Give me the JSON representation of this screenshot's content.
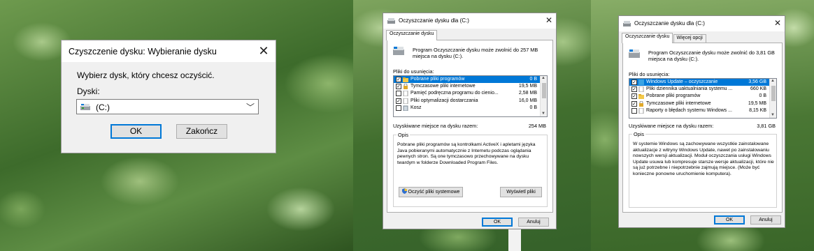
{
  "dialog1": {
    "title": "Czyszczenie dysku: Wybieranie dysku",
    "prompt": "Wybierz dysk, który chcesz oczyścić.",
    "drives_label": "Dyski:",
    "selected_drive": "(C:)",
    "ok": "OK",
    "cancel": "Zakończ"
  },
  "dialog2": {
    "title": "Oczyszczanie dysku dla  (C:)",
    "tab": "Oczyszczanie dysku",
    "summary": "Program Oczyszczanie dysku może zwolnić do 257 MB miejsca na dysku  (C:).",
    "files_label": "Pliki do usunięcia:",
    "files": [
      {
        "name": "Pobrane pliki programów",
        "size": "0 B",
        "checked": true,
        "selected": true,
        "icon": "folder-icon"
      },
      {
        "name": "Tymczasowe pliki internetowe",
        "size": "19,5 MB",
        "checked": true,
        "selected": false,
        "icon": "lock-icon"
      },
      {
        "name": "Pamięć podręczna programu do cienio...",
        "size": "2,58 MB",
        "checked": false,
        "selected": false,
        "icon": "file-icon"
      },
      {
        "name": "Pliki optymalizacji dostarczania",
        "size": "16,0 MB",
        "checked": true,
        "selected": false,
        "icon": "file-icon"
      },
      {
        "name": "Kosz",
        "size": "0 B",
        "checked": false,
        "selected": false,
        "icon": "recycle-bin-icon"
      }
    ],
    "total_label": "Uzyskiwane miejsce na dysku razem:",
    "total_value": "254 MB",
    "desc_legend": "Opis",
    "description": "Pobrane pliki programów są kontrolkami ActiveX i apletami języka Java pobieranymi automatycznie z Internetu podczas oglądania pewnych stron. Są one tymczasowo przechowywane na dysku twardym w folderze Downloaded Program Files.",
    "cleanup_system_button": "Oczyść pliki systemowe",
    "view_files_button": "Wyświetl pliki",
    "ok": "OK",
    "cancel": "Anuluj"
  },
  "dialog3": {
    "title": "Oczyszczanie dysku dla  (C:)",
    "tab1": "Oczyszczanie dysku",
    "tab2": "Więcej opcji",
    "summary": "Program Oczyszczanie dysku może zwolnić do 3,81 GB miejsca na dysku  (C:).",
    "files_label": "Pliki do usunięcia:",
    "files": [
      {
        "name": "Windows Update – oczyszczanie",
        "size": "3,56 GB",
        "checked": true,
        "selected": true,
        "icon": "windows-update-icon"
      },
      {
        "name": "Pliki dziennika uaktualniania systemu ...",
        "size": "660 KB",
        "checked": true,
        "selected": false,
        "icon": "file-icon"
      },
      {
        "name": "Pobrane pliki programów",
        "size": "0 B",
        "checked": true,
        "selected": false,
        "icon": "folder-icon"
      },
      {
        "name": "Tymczasowe pliki internetowe",
        "size": "19,5 MB",
        "checked": true,
        "selected": false,
        "icon": "lock-icon"
      },
      {
        "name": "Raporty o błędach systemu Windows ...",
        "size": "8,15 KB",
        "checked": false,
        "selected": false,
        "icon": "file-icon"
      }
    ],
    "total_label": "Uzyskiwane miejsce na dysku razem:",
    "total_value": "3,81 GB",
    "desc_legend": "Opis",
    "description": "W systemie Windows są zachowywane wszystkie zainstalowane aktualizacje z witryny Windows Update, nawet po zainstalowaniu nowszych wersji aktualizacji. Moduł oczyszczania usługi Windows Update usuwa lub kompresuje starsze wersje aktualizacji, które nie są już potrzebne i niepotrzebnie zajmują miejsce. (Może być konieczne ponowne uruchomienie komputera).",
    "ok": "OK",
    "cancel": "Anuluj"
  },
  "colors": {
    "selection": "#0078d7",
    "dialog_bg": "#f0f0f0",
    "button_bg": "#e1e1e1"
  }
}
